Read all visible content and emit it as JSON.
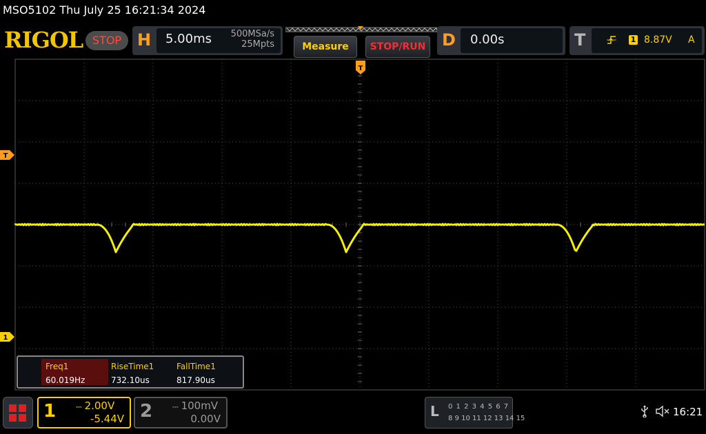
{
  "title": "MSO5102  Thu July 25 16:21:34 2024",
  "brand": "RIGOL",
  "run_state": "STOP",
  "horizontal": {
    "letter": "H",
    "time_scale": "5.00ms",
    "sample_rate": "500MSa/s",
    "memory_depth": "25Mpts"
  },
  "buttons": {
    "measure": "Measure",
    "stop_run": "STOP/RUN"
  },
  "delay": {
    "letter": "D",
    "value": "0.00s"
  },
  "trigger": {
    "letter": "T",
    "edge_icon": "rising-edge-icon",
    "source": "1",
    "level": "8.87V",
    "mode": "A"
  },
  "markers": {
    "trigger_time": "T",
    "trigger_level": "T",
    "ch1_ground": "1"
  },
  "measurements": [
    {
      "name": "Freq1",
      "value": "60.019Hz"
    },
    {
      "name": "RiseTime1",
      "value": "732.10us"
    },
    {
      "name": "FallTime1",
      "value": "817.90us"
    }
  ],
  "channel1": {
    "number": "1",
    "coupling_icon": "dc-coupling-icon",
    "scale": "2.00V",
    "offset": "-5.44V",
    "color": "#fdd000"
  },
  "channel2": {
    "number": "2",
    "coupling_icon": "dc-coupling-icon",
    "scale": "100mV",
    "offset": "0.00V",
    "color": "#9a9a9a"
  },
  "logic": {
    "letter": "L",
    "row1": "0 1 2 3  4 5 6 7",
    "row2": "8 9 10 11 12 13 14 15"
  },
  "status": {
    "clock": "16:21",
    "usb_icon": "usb-icon",
    "speaker_icon": "speaker-muted-icon"
  },
  "colors": {
    "trace": "#f5f000",
    "accent": "#ff9d1f",
    "stop": "#ff2a2a"
  }
}
